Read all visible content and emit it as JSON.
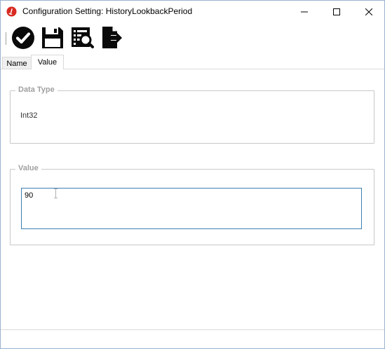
{
  "window": {
    "title": "Configuration Setting: HistoryLookbackPeriod",
    "icon": "app-logo-icon"
  },
  "window_controls": {
    "minimize_icon": "minimize-icon",
    "maximize_icon": "maximize-icon",
    "close_icon": "close-icon"
  },
  "toolbar": {
    "buttons": [
      {
        "icon": "checkmark-circle-icon",
        "tooltip": "Save and close"
      },
      {
        "icon": "floppy-disk-icon",
        "tooltip": "Save"
      },
      {
        "icon": "document-search-icon",
        "tooltip": "Preview"
      },
      {
        "icon": "export-icon",
        "tooltip": "Export"
      }
    ]
  },
  "tabs": [
    {
      "label": "Name",
      "active": false
    },
    {
      "label": "Value",
      "active": true
    }
  ],
  "data_type": {
    "legend": "Data Type",
    "value": "Int32"
  },
  "value_group": {
    "legend": "Value",
    "value": "90"
  },
  "colors": {
    "accent_border": "#3c7fb1",
    "group_border": "#c8c8c8",
    "legend_text": "#a0a0a0",
    "app_icon_red": "#d82a20"
  }
}
